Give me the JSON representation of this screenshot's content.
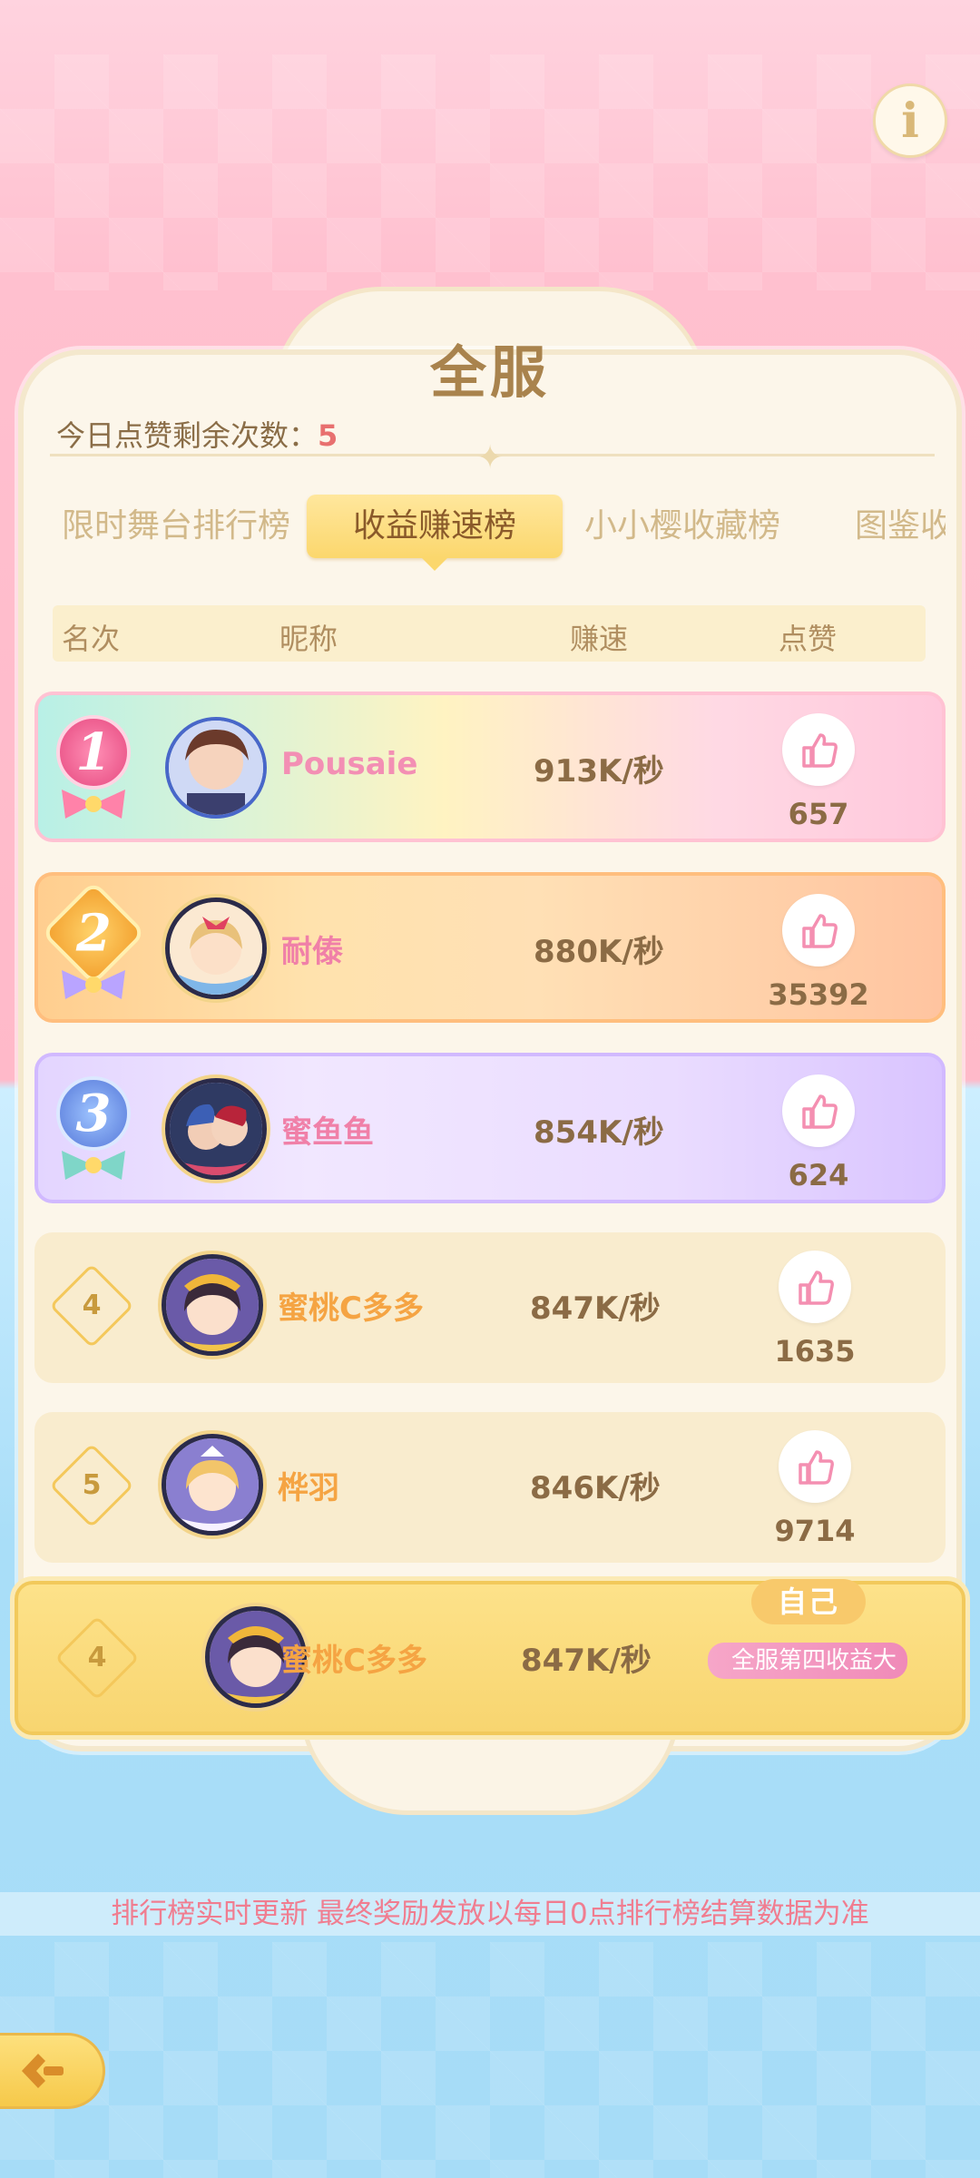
{
  "header": {
    "title": "全服",
    "likes_left_label": "今日点赞剩余次数：",
    "likes_left_value": "5"
  },
  "tabs": [
    {
      "label": "限时舞台排行榜",
      "active": false
    },
    {
      "label": "收益赚速榜",
      "active": true
    },
    {
      "label": "小小樱收藏榜",
      "active": false
    },
    {
      "label": "图鉴收",
      "active": false
    }
  ],
  "columns": {
    "rank": "名次",
    "nickname": "昵称",
    "speed": "赚速",
    "likes": "点赞"
  },
  "rows": [
    {
      "rank": "1",
      "nickname": "Pousaie",
      "speed": "913K/秒",
      "likes": "657"
    },
    {
      "rank": "2",
      "nickname": "耐傣",
      "speed": "880K/秒",
      "likes": "35392"
    },
    {
      "rank": "3",
      "nickname": "蜜鱼鱼",
      "speed": "854K/秒",
      "likes": "624"
    },
    {
      "rank": "4",
      "nickname": "蜜桃C多多",
      "speed": "847K/秒",
      "likes": "1635"
    },
    {
      "rank": "5",
      "nickname": "桦羽",
      "speed": "846K/秒",
      "likes": "9714"
    }
  ],
  "self_row": {
    "rank": "4",
    "nickname": "蜜桃C多多",
    "speed": "847K/秒",
    "tag": "自己",
    "title_badge": "全服第四收益大"
  },
  "footer": {
    "note": "排行榜实时更新 最终奖励发放以每日0点排行榜结算数据为准"
  },
  "icons": {
    "info": "info-icon",
    "like": "thumbs-up-icon",
    "back": "back-arrow-icon"
  },
  "colors": {
    "accent_pink": "#f080a8",
    "accent_gold": "#f5a443",
    "text_brown": "#8b6b45",
    "highlight": "#e8706f"
  }
}
